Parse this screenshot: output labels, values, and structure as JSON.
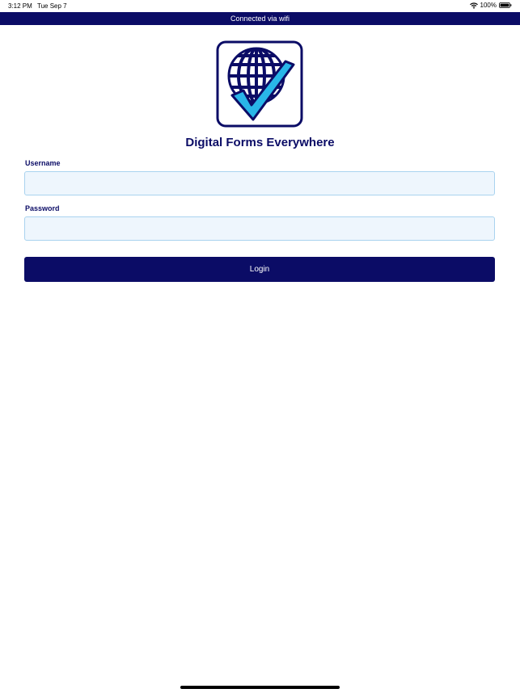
{
  "status_bar": {
    "time": "3:12 PM",
    "date": "Tue Sep 7",
    "battery": "100%",
    "wifi_icon": "wifi-icon",
    "battery_icon": "battery-icon"
  },
  "banner": {
    "text": "Connected via wifi",
    "color": "#0b0c66"
  },
  "logo": {
    "icon": "globe-checkmark-logo"
  },
  "app": {
    "title": "Digital Forms Everywhere"
  },
  "form": {
    "username_label": "Username",
    "username_value": "",
    "password_label": "Password",
    "password_value": "",
    "login_label": "Login"
  },
  "colors": {
    "primary": "#0b0c66",
    "input_bg": "#eef6fd",
    "input_border": "#a9d3ef",
    "check": "#29b6e8"
  }
}
